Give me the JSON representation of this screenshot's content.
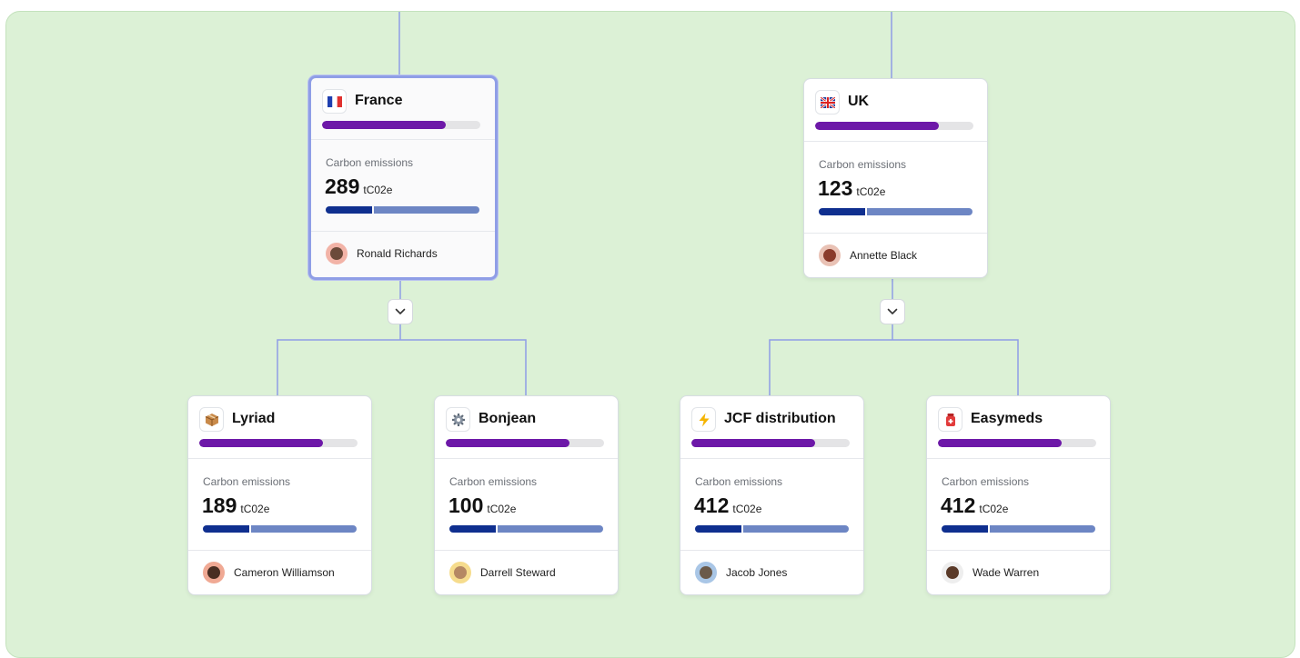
{
  "diagram": {
    "metric_label": "Carbon emissions",
    "unit": "tC02e",
    "nodes": [
      {
        "id": "france",
        "title": "France",
        "icon": "france-flag-icon",
        "value": "289",
        "person": "Ronald Richards",
        "selected": true,
        "progress": 0.78
      },
      {
        "id": "uk",
        "title": "UK",
        "icon": "uk-flag-icon",
        "value": "123",
        "person": "Annette Black",
        "selected": false,
        "progress": 0.78
      },
      {
        "id": "lyriad",
        "title": "Lyriad",
        "icon": "package-icon",
        "value": "189",
        "person": "Cameron Williamson",
        "selected": false,
        "progress": 0.78
      },
      {
        "id": "bonjean",
        "title": "Bonjean",
        "icon": "gear-icon",
        "value": "100",
        "person": "Darrell Steward",
        "selected": false,
        "progress": 0.78
      },
      {
        "id": "jcf",
        "title": "JCF distribution",
        "icon": "lightning-icon",
        "value": "412",
        "person": "Jacob Jones",
        "selected": false,
        "progress": 0.78
      },
      {
        "id": "easymeds",
        "title": "Easymeds",
        "icon": "pharmacy-icon",
        "value": "412",
        "person": "Wade Warren",
        "selected": false,
        "progress": 0.78
      }
    ],
    "edges": [
      [
        "france",
        "lyriad"
      ],
      [
        "france",
        "bonjean"
      ],
      [
        "uk",
        "jcf"
      ],
      [
        "uk",
        "easymeds"
      ]
    ],
    "split_fraction": 0.3,
    "colors": {
      "background": "#dcf1d6",
      "progress": "#6d18a8",
      "emission_dark": "#0f2f8f",
      "emission_light": "#6d86c4",
      "connector": "#8f9ee6"
    }
  }
}
